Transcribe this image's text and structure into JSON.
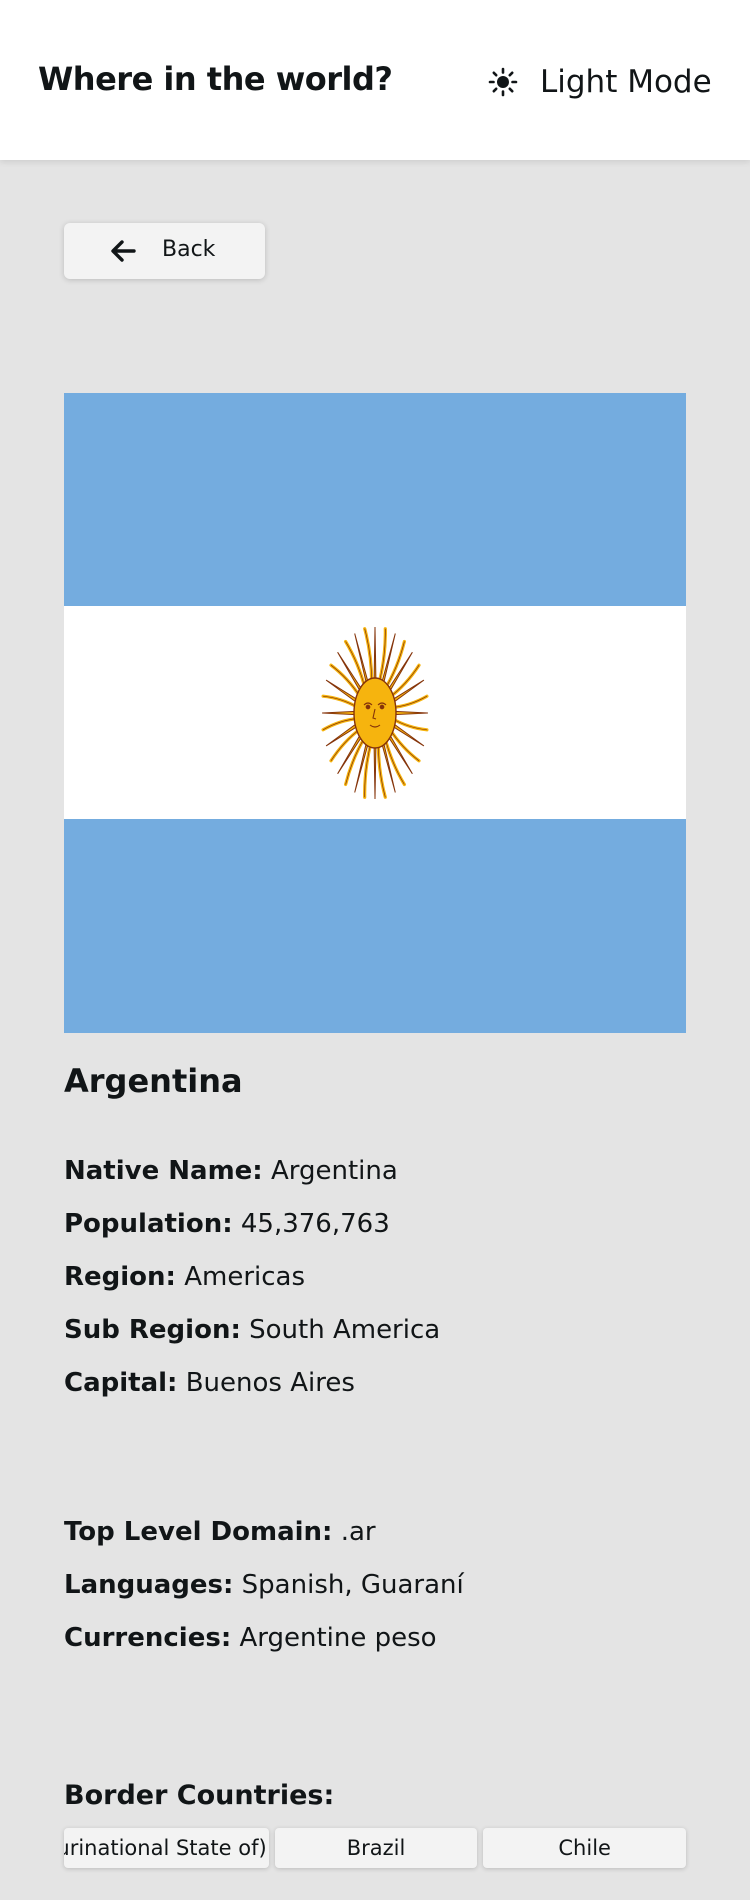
{
  "header": {
    "title": "Where in the world?",
    "mode_label": "Light Mode",
    "mode_icon": "sun-icon"
  },
  "back": {
    "label": "Back",
    "icon": "arrow-left-icon"
  },
  "flag": {
    "country": "Argentina",
    "colors": {
      "sky_blue": "#74acdf",
      "white": "#ffffff",
      "sun_yellow": "#f6b40e",
      "sun_stroke": "#85340a"
    }
  },
  "country": {
    "name": "Argentina",
    "native_name_label": "Native Name:",
    "native_name": "Argentina",
    "population_label": "Population:",
    "population": "45,376,763",
    "region_label": "Region:",
    "region": "Americas",
    "subregion_label": "Sub Region:",
    "subregion": "South America",
    "capital_label": "Capital:",
    "capital": "Buenos Aires",
    "tld_label": "Top Level Domain:",
    "tld": ".ar",
    "languages_label": "Languages:",
    "languages": "Spanish, Guaraní",
    "currencies_label": "Currencies:",
    "currencies": "Argentine peso"
  },
  "borders": {
    "title": "Border Countries:",
    "items": [
      "Bolivia (Plurinational State of)",
      "Brazil",
      "Chile"
    ]
  },
  "colors": {
    "background": "#e4e4e4",
    "header_bg": "#ffffff",
    "chip_bg": "#f3f3f3",
    "text": "#111517"
  }
}
